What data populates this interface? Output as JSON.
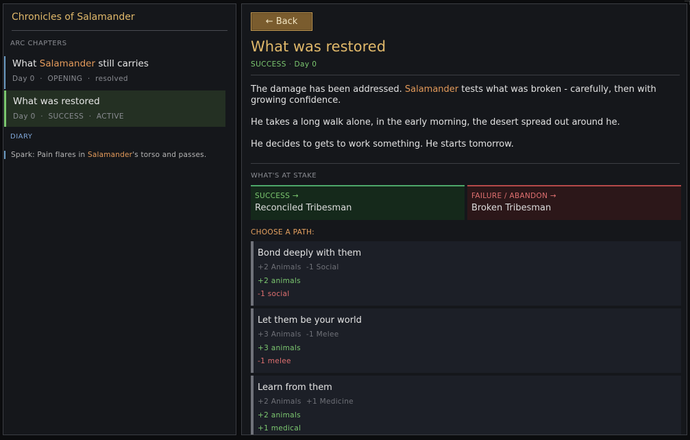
{
  "sidebar": {
    "title": "Chronicles of Salamander",
    "arc_label": "ARC CHAPTERS",
    "chapters": [
      {
        "pre": "What ",
        "name": "Salamander",
        "post": " still carries",
        "meta": "Day 0  ·  OPENING  ·  resolved"
      },
      {
        "title": "What was restored",
        "meta": "Day 0  ·  SUCCESS  ·  ACTIVE"
      }
    ],
    "diary_label": "DIARY",
    "diary": [
      {
        "pre": "Spark: Pain flares in ",
        "name": "Salamander",
        "post": "'s torso and passes."
      }
    ]
  },
  "main": {
    "back_label": "← Back",
    "title": "What was restored",
    "meta_outcome": "SUCCESS",
    "meta_sep": "·",
    "meta_day": "Day 0",
    "para1_pre": "The damage has been addressed. ",
    "para1_name": "Salamander",
    "para1_post": " tests what was broken - carefully, then with growing confidence.",
    "para2": "He takes a long walk alone, in the early morning, the desert spread out around he.",
    "para3": "He decides to gets to work something. He starts tomorrow.",
    "stake_label": "WHAT'S AT STAKE",
    "success_key": "SUCCESS →",
    "success_value": "Reconciled Tribesman",
    "failure_key": "FAILURE / ABANDON →",
    "failure_value": "Broken Tribesman",
    "choose_label": "CHOOSE A PATH:",
    "paths": [
      {
        "title": "Bond deeply with them",
        "summary": "+2 Animals  -1 Social",
        "pos": "+2 animals",
        "neg": "-1 social"
      },
      {
        "title": "Let them be your world",
        "summary": "+3 Animals  -1 Melee",
        "pos": "+3 animals",
        "neg": "-1 melee"
      },
      {
        "title": "Learn from them",
        "summary": "+2 Animals  +1 Medicine",
        "pos": "+2 animals",
        "neg": "+1 medical"
      }
    ]
  },
  "colors": {
    "accent": "#e0b86a",
    "success": "#7cc870",
    "failure": "#e07070",
    "highlight": "#e39a5a"
  }
}
